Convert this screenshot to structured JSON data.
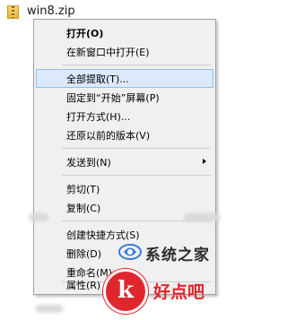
{
  "file": {
    "name": "win8.zip",
    "icon": "zip-folder-icon"
  },
  "menu": {
    "items": [
      {
        "label": "打开(O)"
      },
      {
        "label": "在新窗口中打开(E)"
      },
      {
        "label": "全部提取(T)..."
      },
      {
        "label": "固定到“开始”屏幕(P)"
      },
      {
        "label": "打开方式(H)..."
      },
      {
        "label": "还原以前的版本(V)"
      },
      {
        "label": "发送到(N)"
      },
      {
        "label": "剪切(T)"
      },
      {
        "label": "复制(C)"
      },
      {
        "label": "创建快捷方式(S)"
      },
      {
        "label": "删除(D)"
      },
      {
        "label": "重命名(M)"
      },
      {
        "label": "属性(R)"
      }
    ]
  },
  "watermarks": {
    "site1": "系统之家",
    "site2": "好点吧",
    "site2_logo": "k"
  },
  "colors": {
    "hover_bg": "#dbe9fb",
    "hover_border": "#90c0f2",
    "watermark_red": "#e0262d"
  }
}
